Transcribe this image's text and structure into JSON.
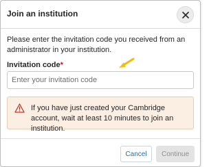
{
  "dialog": {
    "title": "Join an institution",
    "intro": "Please enter the invitation code you received from an administrator in your institution.",
    "close_icon": "close-icon"
  },
  "field": {
    "label": "Invitation code",
    "required_marker": "*",
    "placeholder": "Enter your invitation code",
    "value": ""
  },
  "annotation": {
    "icon": "arrow-pointer-icon",
    "color": "#f2c318"
  },
  "warning": {
    "icon": "warning-triangle-icon",
    "text": "If you have just created your Cambridge account, wait at least 10 minutes to join an institution.",
    "background": "#fbeee2",
    "icon_color": "#c0392b"
  },
  "footer": {
    "cancel_label": "Cancel",
    "continue_label": "Continue",
    "continue_disabled": true
  },
  "colors": {
    "link_blue": "#2d6ab0",
    "required_red": "#c8102e"
  }
}
